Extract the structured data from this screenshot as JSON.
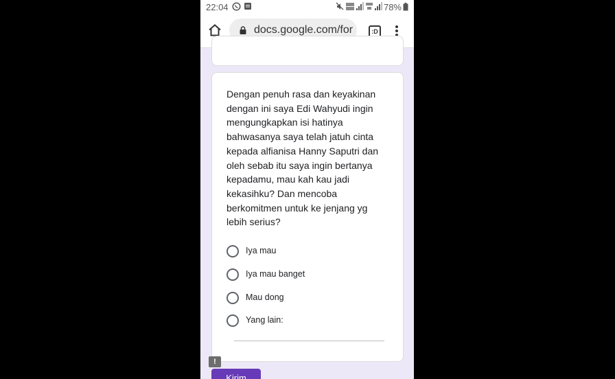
{
  "status_bar": {
    "time": "22:04",
    "battery": "78%",
    "icons": [
      "whatsapp-icon",
      "message-icon",
      "mute-icon",
      "volte-icon",
      "signal-icon",
      "4g-icon",
      "signal-icon",
      "battery-icon"
    ]
  },
  "browser": {
    "url": "docs.google.com/for",
    "tab_count": ":D",
    "icons": [
      "home-icon",
      "lock-icon",
      "tabs-icon",
      "more-vertical-icon"
    ]
  },
  "form": {
    "question": "Dengan penuh rasa dan keyakinan dengan ini saya Edi Wahyudi ingin mengungkapkan isi hatinya bahwasanya saya telah jatuh cinta kepada alfianisa Hanny Saputri dan oleh sebab itu saya ingin bertanya kepadamu, mau kah kau jadi kekasihku? Dan mencoba berkomitmen untuk ke jenjang yg lebih serius?",
    "options": [
      {
        "label": "Iya mau"
      },
      {
        "label": "Iya mau banget"
      },
      {
        "label": "Mau dong"
      },
      {
        "label": "Yang lain:"
      }
    ],
    "submit_label": "Kirim",
    "feedback_icon": "!"
  },
  "colors": {
    "background": "#ede8f7",
    "accent": "#673ab7"
  }
}
